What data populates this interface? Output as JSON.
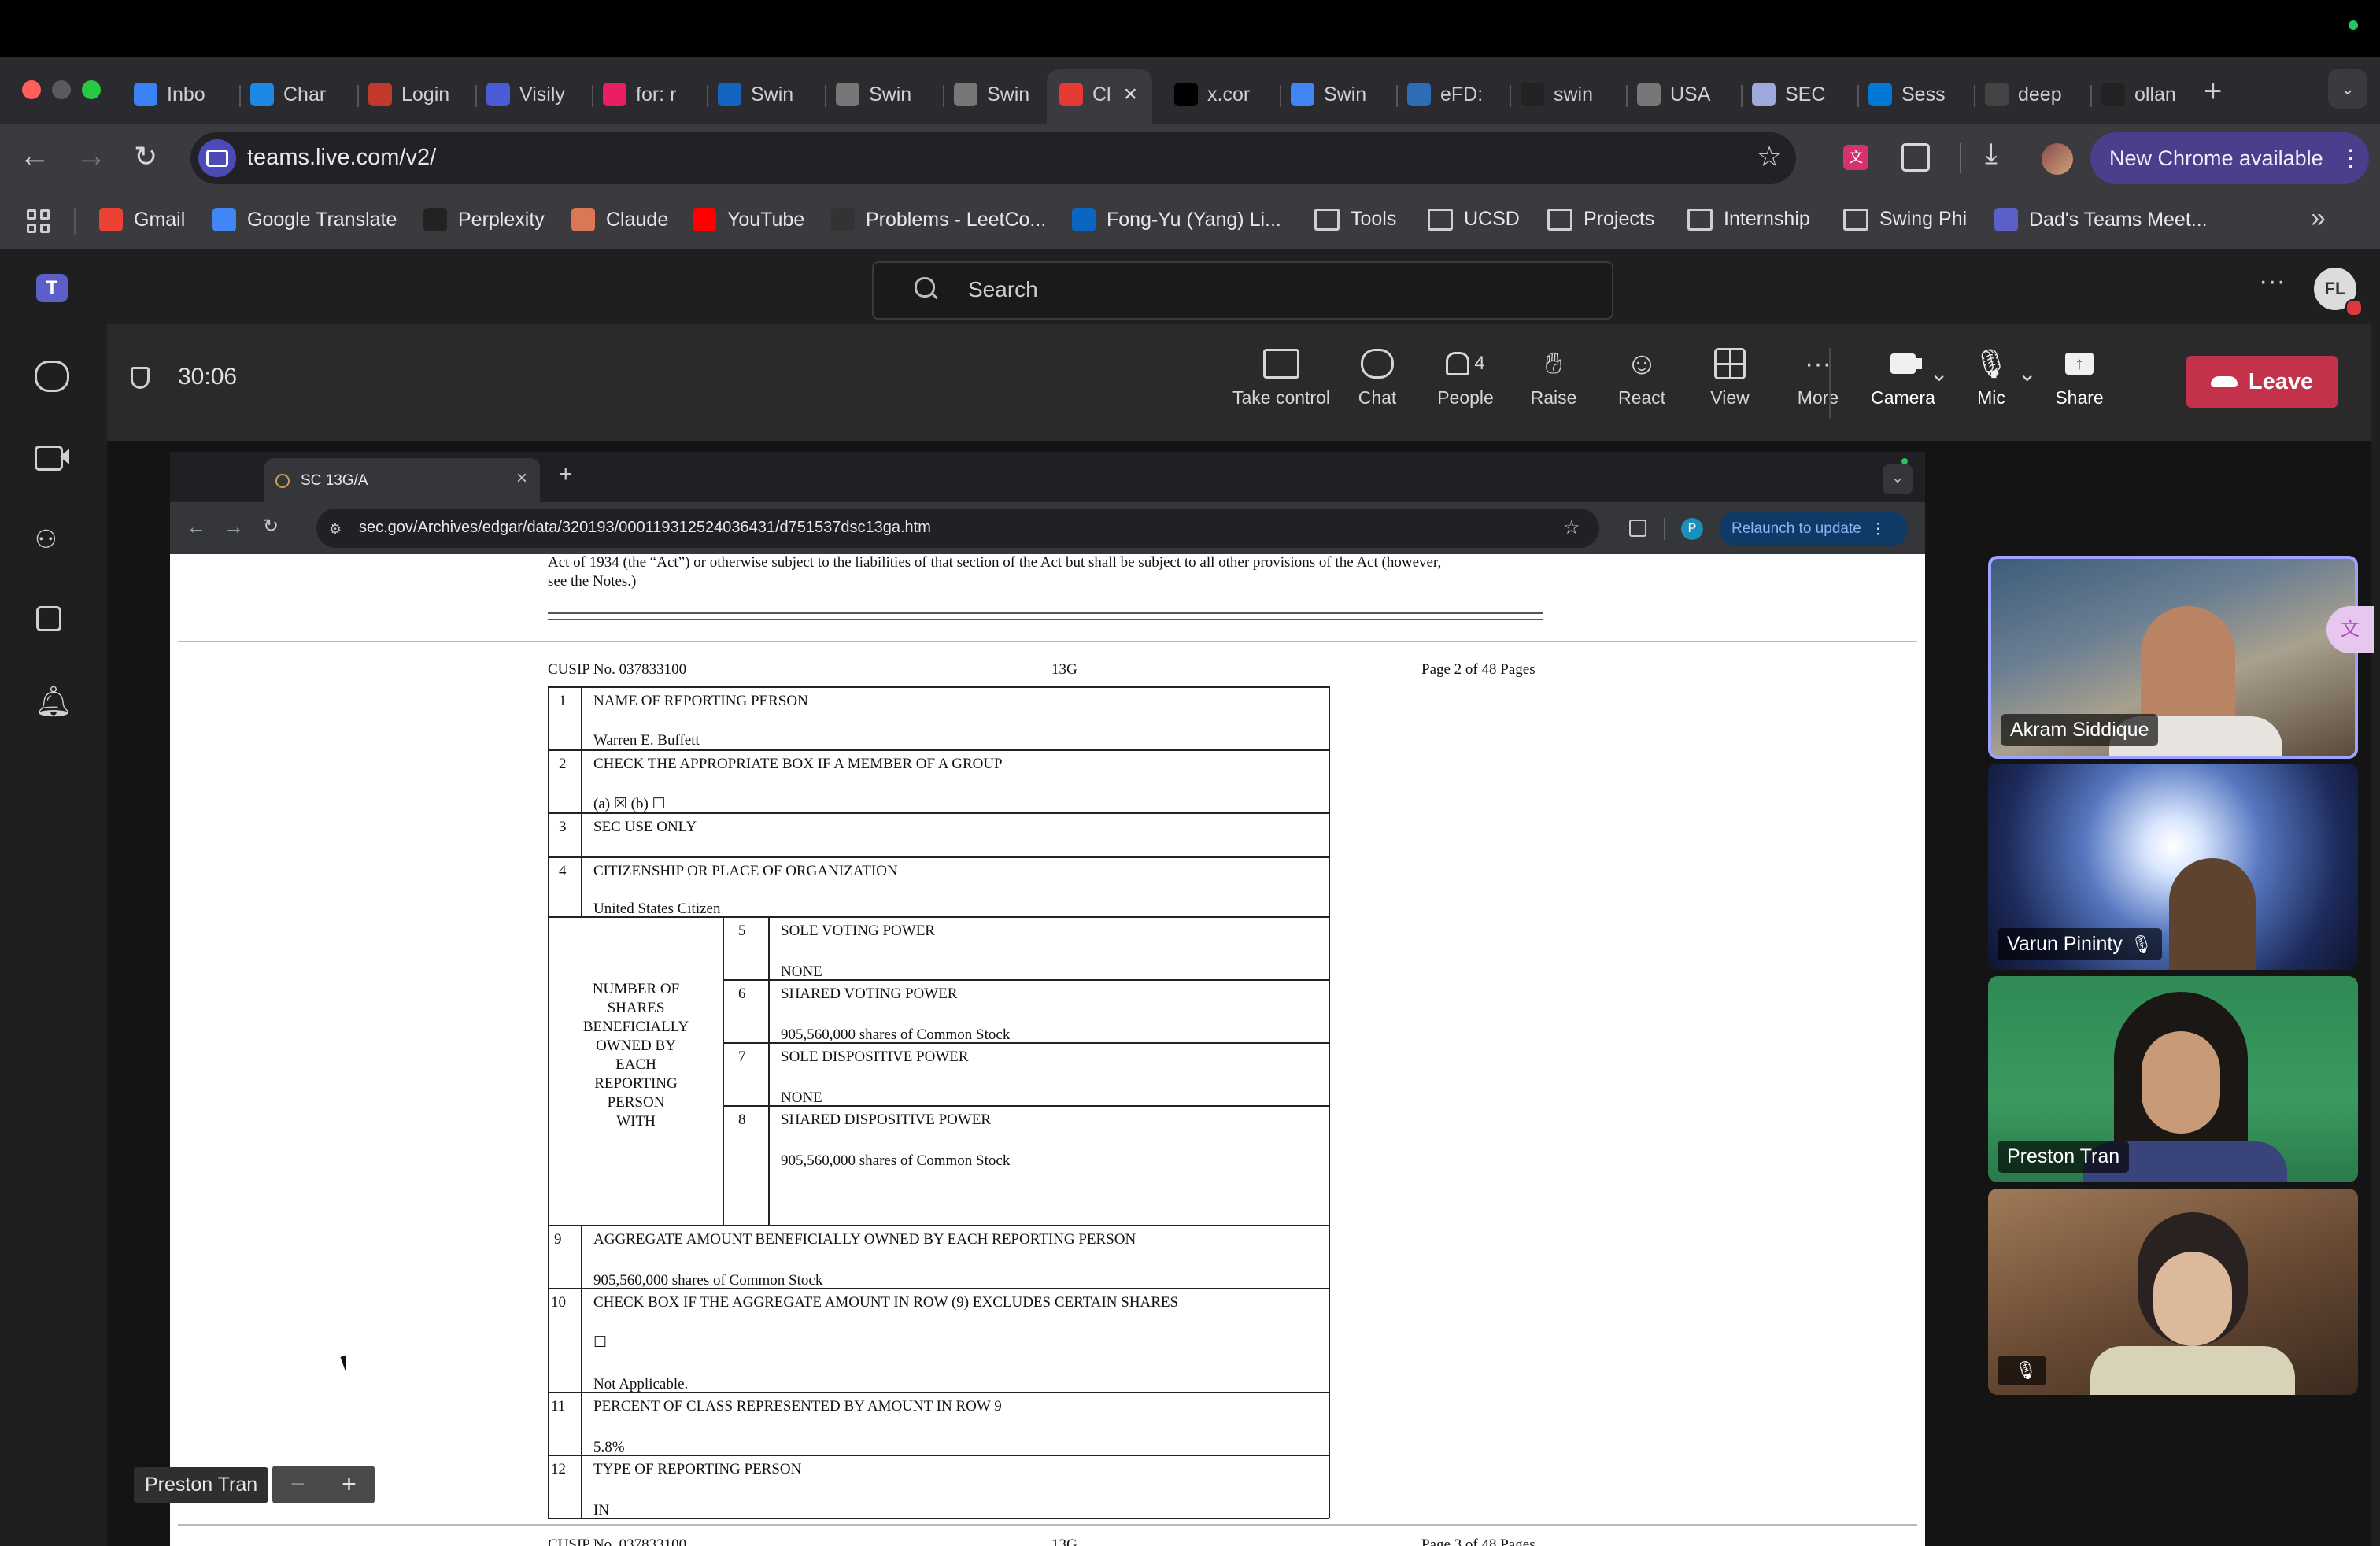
{
  "chrome": {
    "tabs": [
      {
        "label": "Inbo",
        "icon": "gmail-icon",
        "color": "#3b82f6"
      },
      {
        "label": "Char",
        "icon": "calendar-icon",
        "color": "#1e88e5"
      },
      {
        "label": "Login",
        "icon": "login-icon",
        "color": "#c0392b"
      },
      {
        "label": "Visily",
        "icon": "visily-icon",
        "color": "#4b5bd6"
      },
      {
        "label": "for: r",
        "icon": "figma-icon",
        "color": "#e91e63"
      },
      {
        "label": "Swin",
        "icon": "box-icon",
        "color": "#1565c0"
      },
      {
        "label": "Swin",
        "icon": "globe-icon",
        "color": "#777"
      },
      {
        "label": "Swin",
        "icon": "globe-icon",
        "color": "#777"
      },
      {
        "label": "Cl",
        "icon": "recording-icon",
        "color": "#e53935"
      },
      {
        "label": "x.cor",
        "icon": "x-icon",
        "color": "#000"
      },
      {
        "label": "Swin",
        "icon": "docs-icon",
        "color": "#4285f4"
      },
      {
        "label": "eFD:",
        "icon": "efd-icon",
        "color": "#2c6db5"
      },
      {
        "label": "swin",
        "icon": "github-icon",
        "color": "#222"
      },
      {
        "label": "USA",
        "icon": "globe-icon",
        "color": "#777"
      },
      {
        "label": "SEC",
        "icon": "sec-icon",
        "color": "#9fa8da"
      },
      {
        "label": "Sess",
        "icon": "azure-icon",
        "color": "#0078d4"
      },
      {
        "label": "deep",
        "icon": "openai-icon",
        "color": "#444"
      },
      {
        "label": "ollan",
        "icon": "github-icon",
        "color": "#222"
      }
    ],
    "url": "teams.live.com/v2/",
    "update_label": "New Chrome available",
    "bookmarks": [
      {
        "label": "Gmail",
        "icon": "gmail-icon"
      },
      {
        "label": "Google Translate",
        "icon": "translate-icon"
      },
      {
        "label": "Perplexity",
        "icon": "perplexity-icon"
      },
      {
        "label": "Claude",
        "icon": "claude-icon"
      },
      {
        "label": "YouTube",
        "icon": "youtube-icon"
      },
      {
        "label": "Problems - LeetCo...",
        "icon": "leetcode-icon"
      },
      {
        "label": "Fong-Yu (Yang) Li...",
        "icon": "linkedin-icon"
      },
      {
        "label": "Tools",
        "icon": "folder-icon"
      },
      {
        "label": "UCSD",
        "icon": "folder-icon"
      },
      {
        "label": "Projects",
        "icon": "folder-icon"
      },
      {
        "label": "Internship",
        "icon": "folder-icon"
      },
      {
        "label": "Swing Phi",
        "icon": "folder-icon"
      },
      {
        "label": "Dad's Teams Meet...",
        "icon": "teams-icon"
      }
    ]
  },
  "teams": {
    "search_placeholder": "Search",
    "avatar_initials": "FL",
    "timer": "30:06",
    "controls": {
      "take_control": "Take control",
      "chat": "Chat",
      "people": "People",
      "people_count": "4",
      "raise": "Raise",
      "react": "React",
      "view": "View",
      "more": "More",
      "camera": "Camera",
      "mic": "Mic",
      "share": "Share",
      "leave": "Leave"
    },
    "presenter_label": "Preston Tran",
    "participants": [
      {
        "name": "Akram Siddique",
        "muted": false
      },
      {
        "name": "Varun Pininty",
        "muted": true
      },
      {
        "name": "Preston Tran",
        "muted": false
      },
      {
        "name": "",
        "muted": true
      }
    ]
  },
  "shared": {
    "tab_title": "SC 13G/A",
    "url": "sec.gov/Archives/edgar/data/320193/000119312524036431/d751537dsc13ga.htm",
    "profile_initial": "P",
    "relaunch_label": "Relaunch to update",
    "doc": {
      "intro_1": "Act of 1934 (the “Act”) or otherwise subject to the liabilities of that section of the Act but shall be subject to all other provisions of the Act (however,",
      "intro_2": "see the Notes.)",
      "cusip": "CUSIP No. 037833100",
      "form": "13G",
      "page": "Page 2 of 48 Pages",
      "next_cusip": "CUSIP No. 037833100",
      "next_form": "13G",
      "next_page": "Page 3 of 48 Pages",
      "rows": {
        "r1_num": "1",
        "r1_label": "NAME OF REPORTING PERSON",
        "r1_value": "Warren E. Buffett",
        "r2_num": "2",
        "r2_label": "CHECK THE APPROPRIATE BOX IF A MEMBER OF A GROUP",
        "r2_value": "(a) ☒        (b) ☐",
        "r3_num": "3",
        "r3_label": "SEC USE ONLY",
        "r4_num": "4",
        "r4_label": "CITIZENSHIP OR PLACE OF ORGANIZATION",
        "r4_value": "United States Citizen",
        "shares_label": [
          "NUMBER OF",
          "SHARES",
          "BENEFICIALLY",
          "OWNED BY",
          "EACH",
          "REPORTING",
          "PERSON",
          "WITH"
        ],
        "r5_num": "5",
        "r5_label": "SOLE VOTING POWER",
        "r5_value": "NONE",
        "r6_num": "6",
        "r6_label": "SHARED VOTING POWER",
        "r6_value": "905,560,000 shares of Common Stock",
        "r7_num": "7",
        "r7_label": "SOLE DISPOSITIVE POWER",
        "r7_value": "NONE",
        "r8_num": "8",
        "r8_label": "SHARED DISPOSITIVE POWER",
        "r8_value": "905,560,000 shares of Common Stock",
        "r9_num": "9",
        "r9_label": "AGGREGATE AMOUNT BENEFICIALLY OWNED BY EACH REPORTING PERSON",
        "r9_value": "905,560,000 shares of Common Stock",
        "r10_num": "10",
        "r10_label": "CHECK BOX IF THE AGGREGATE AMOUNT IN ROW (9) EXCLUDES CERTAIN SHARES",
        "r10_box": "☐",
        "r10_value": "Not Applicable.",
        "r11_num": "11",
        "r11_label": "PERCENT OF CLASS REPRESENTED BY AMOUNT IN ROW 9",
        "r11_value": "5.8%",
        "r12_num": "12",
        "r12_label": "TYPE OF REPORTING PERSON",
        "r12_value": "IN"
      }
    }
  },
  "colors": {
    "leave": "#c4314b",
    "teams_purple": "#7f85f5",
    "relaunch": "#8ab4f8",
    "active_border": "#9ea2ff"
  }
}
